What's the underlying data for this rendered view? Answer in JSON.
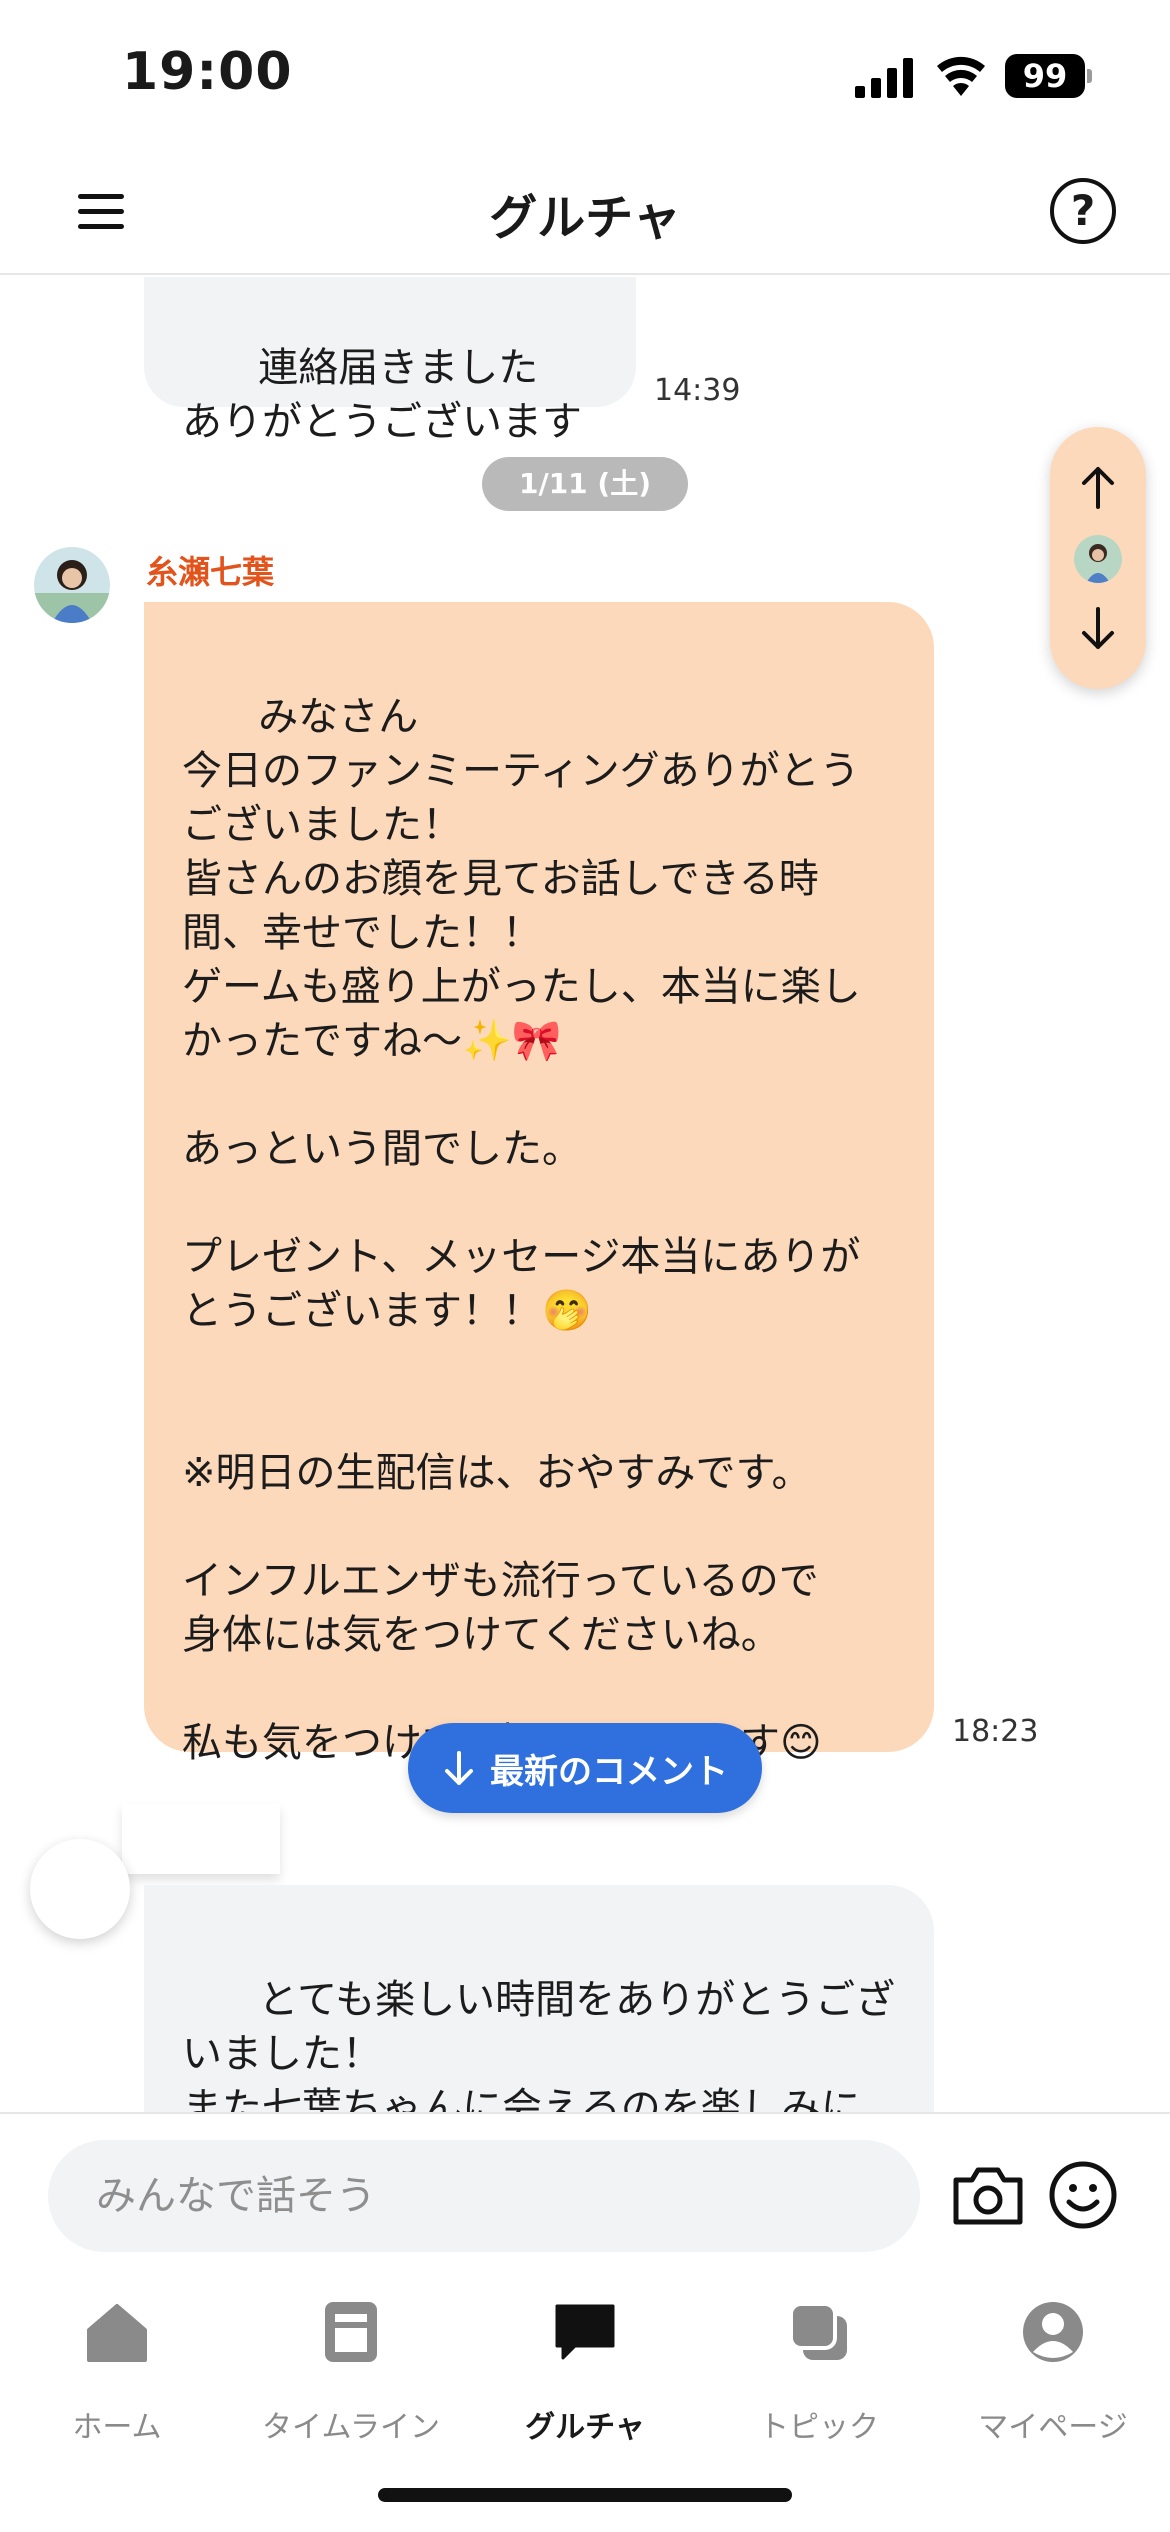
{
  "status_bar": {
    "time": "19:00",
    "battery": "99"
  },
  "header": {
    "title": "グルチャ",
    "help_icon": "?"
  },
  "messages": [
    {
      "text": "連絡届きました\nありがとうございます",
      "time": "14:39"
    },
    {
      "date_divider": "1/11 (土)"
    },
    {
      "sender": "糸瀬七葉",
      "text": "みなさん\n今日のファンミーティングありがとうございました！\n皆さんのお顔を見てお話しできる時間、幸せでした！！\nゲームも盛り上がったし、本当に楽しかったですね〜✨🎀\n\nあっという間でした。\n\nプレゼント、メッセージ本当にありがとうございます！！🤭\n\n\n※明日の生配信は、おやすみです。\n\nインフルエンザも流行っているので\n身体には気をつけてくださいね。\n\n私も気をつけて、撮影頑張ります😊",
      "time": "18:23"
    },
    {
      "text": "とても楽しい時間をありがとうございました！\nまた七葉ちゃんに会えるのを楽しみにしています😊"
    }
  ],
  "latest_button": {
    "label": "最新のコメント"
  },
  "input": {
    "placeholder": "みんなで話そう",
    "value": ""
  },
  "tabs": [
    {
      "label": "ホーム",
      "icon": "home-icon",
      "active": false
    },
    {
      "label": "タイムライン",
      "icon": "timeline-icon",
      "active": false
    },
    {
      "label": "グルチャ",
      "icon": "chat-icon",
      "active": true
    },
    {
      "label": "トピック",
      "icon": "topic-icon",
      "active": false
    },
    {
      "label": "マイページ",
      "icon": "profile-icon",
      "active": false
    }
  ],
  "colors": {
    "accent_blue": "#2f6fde",
    "peach_bubble": "#fdd9bb",
    "gray_bubble": "#f2f3f5",
    "sender_name": "#e2541c"
  }
}
